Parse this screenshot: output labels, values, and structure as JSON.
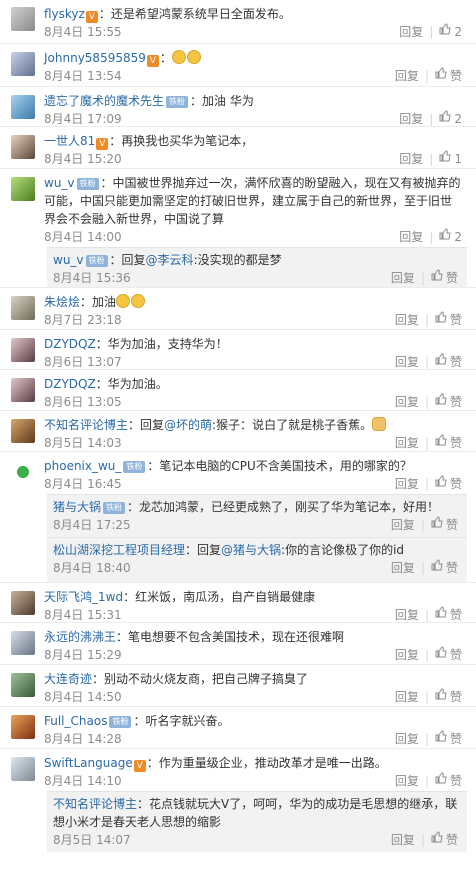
{
  "labels": {
    "reply": "回复",
    "like": "赞"
  },
  "comments": [
    {
      "user": "flyskyz",
      "badge": "vip",
      "text": "：还是希望鸿蒙系统早日全面发布。",
      "time": "8月4日 15:55",
      "likes": "2"
    },
    {
      "user": "Johnny58595859",
      "badge": "vip",
      "text": "：",
      "emojis": 2,
      "time": "8月4日 13:54",
      "likes": ""
    },
    {
      "user": "遗忘了魔术的魔术先生",
      "badge": "fan",
      "text": "：加油  华为",
      "time": "8月4日 17:09",
      "likes": "2"
    },
    {
      "user": "一世人81",
      "badge": "vip",
      "text": "：再换我也买华为笔记本，",
      "time": "8月4日 15:20",
      "likes": "1"
    },
    {
      "user": "wu_v",
      "badge": "fan",
      "text": "：中国被世界抛弃过一次，满怀欣喜的盼望融入，现在又有被抛弃的可能，中国只能更加需坚定的打破旧世界，建立属于自己的新世界，至于旧世界会不会融入新世界，中国说了算",
      "time": "8月4日 14:00",
      "likes": "2"
    },
    {
      "user": "朱烩烩",
      "text": "：加油",
      "emojis": 2,
      "time": "8月7日 23:18",
      "likes": ""
    },
    {
      "user": "DZYDQZ",
      "text": "：华为加油，支持华为！",
      "time": "8月6日 13:07",
      "likes": ""
    },
    {
      "user": "DZYDQZ",
      "text": "：华为加油。",
      "time": "8月6日 13:05",
      "likes": ""
    },
    {
      "user": "不知名评论博主",
      "text": "：回复",
      "mention": "@坏的萌",
      "text2": ":猴子：说白了就是桃子香蕉。",
      "hand": true,
      "time": "8月5日 14:03",
      "likes": ""
    },
    {
      "user": "phoenix_wu_",
      "badge": "fan",
      "text": "：笔记本电脑的CPU不含美国技术，用的哪家的？",
      "time": "8月4日 16:45",
      "likes": ""
    },
    {
      "user": "天际飞鸿_1wd",
      "text": "：红米饭，南瓜汤，自产自销最健康",
      "time": "8月4日 15:31",
      "likes": ""
    },
    {
      "user": "永远的沸沸王",
      "text": "：笔电想要不包含美国技术，现在还很难啊",
      "time": "8月4日 15:29",
      "likes": ""
    },
    {
      "user": "大连奇迹",
      "text": "：别动不动火烧友商，把自己牌子搞臭了",
      "time": "8月4日 14:50",
      "likes": ""
    },
    {
      "user": "Full_Chaos",
      "badge": "fan",
      "text": "：听名字就兴奋。",
      "time": "8月4日 14:28",
      "likes": ""
    },
    {
      "user": "SwiftLanguage",
      "badge": "vip",
      "text": "：作为重量级企业，推动改革才是唯一出路。",
      "time": "8月4日 14:10",
      "likes": ""
    }
  ],
  "replies": [
    {
      "user": "wu_v",
      "badge": "fan",
      "text": "：回复",
      "mention": "@李云科",
      "text2": ":没实现的都是梦",
      "time": "8月4日 15:36"
    },
    {
      "user": "猪与大锅",
      "badge": "fan",
      "text": "：龙芯加鸿蒙，已经更成熟了，刚买了华为笔记本，好用！",
      "time": "8月4日 17:25"
    },
    {
      "user": "松山湖深挖工程项目经理",
      "text": "：回复",
      "mention": "@猪与大锅",
      "text2": ":你的言论像极了你的id",
      "time": "8月4日 18:40"
    },
    {
      "user": "不知名评论博主",
      "text": "：花点钱就玩大V了，呵呵，华为的成功是毛思想的继承，联想小米才是春天老人思想的缩影",
      "time": "8月5日 14:07"
    }
  ]
}
